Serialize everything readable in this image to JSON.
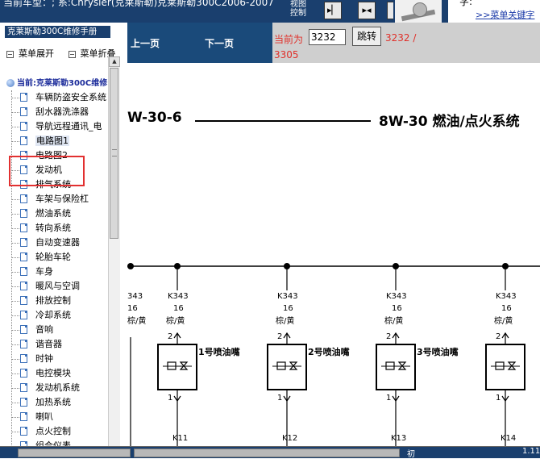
{
  "window": {
    "title": "当前车型：; 系:Chrysler(克莱斯勒)克莱斯勒300C2006-2007",
    "control_label": "视图控制",
    "help_q": "字:",
    "help_link": ">>菜单关键字"
  },
  "sidebar": {
    "title": "克莱斯勒300C维修手册",
    "expand_label": "菜单展开",
    "collapse_label": "菜单折叠",
    "current": "当前:克莱斯勒300C维修",
    "items": [
      {
        "label": "车辆防盗安全系统"
      },
      {
        "label": "刮水器洗涤器"
      },
      {
        "label": "导航远程通讯_电"
      },
      {
        "label": "电路图1",
        "selected": true
      },
      {
        "label": "电路图2"
      },
      {
        "label": "发动机"
      },
      {
        "label": "排气系统"
      },
      {
        "label": "车架与保险杠"
      },
      {
        "label": "燃油系统"
      },
      {
        "label": "转向系统"
      },
      {
        "label": "自动变速器"
      },
      {
        "label": "轮胎车轮"
      },
      {
        "label": "车身"
      },
      {
        "label": "暖风与空调"
      },
      {
        "label": "排放控制"
      },
      {
        "label": "冷却系统"
      },
      {
        "label": "音响"
      },
      {
        "label": "谐音器"
      },
      {
        "label": "时钟"
      },
      {
        "label": "电控模块"
      },
      {
        "label": "发动机系统"
      },
      {
        "label": "加热系统"
      },
      {
        "label": "喇叭"
      },
      {
        "label": "点火控制"
      },
      {
        "label": "组合仪表"
      }
    ]
  },
  "nav": {
    "prev_label": "上一页",
    "next_label": "下一页",
    "current_label": "当前为",
    "page_value": "3232",
    "go_label": "跳转",
    "total_a": "3232 /",
    "total_b": "3305"
  },
  "document": {
    "header_left": "W-30-6",
    "header_right": "8W-30 燃油/点火系统",
    "wire_code": "K343",
    "wire_gauge": "16",
    "wire_color": "棕/黄",
    "pin_top": "2",
    "pin_bottom": "1",
    "injectors": [
      "1号喷油嘴",
      "2号喷油嘴",
      "3号喷油嘴"
    ],
    "bottom_codes": [
      "K11",
      "K12",
      "K13",
      "K14"
    ],
    "partial_k343_label": "343",
    "partial_gauge_label": "16",
    "partial_color_label": "棕/黄"
  },
  "status": {
    "seg_mid_text": "初",
    "seg_right_text": "1.11"
  },
  "colors": {
    "dark_blue": "#1a3f6e",
    "nav_blue": "#1a4a7a",
    "red_text": "#e0302a",
    "highlight_red": "#e23030"
  }
}
